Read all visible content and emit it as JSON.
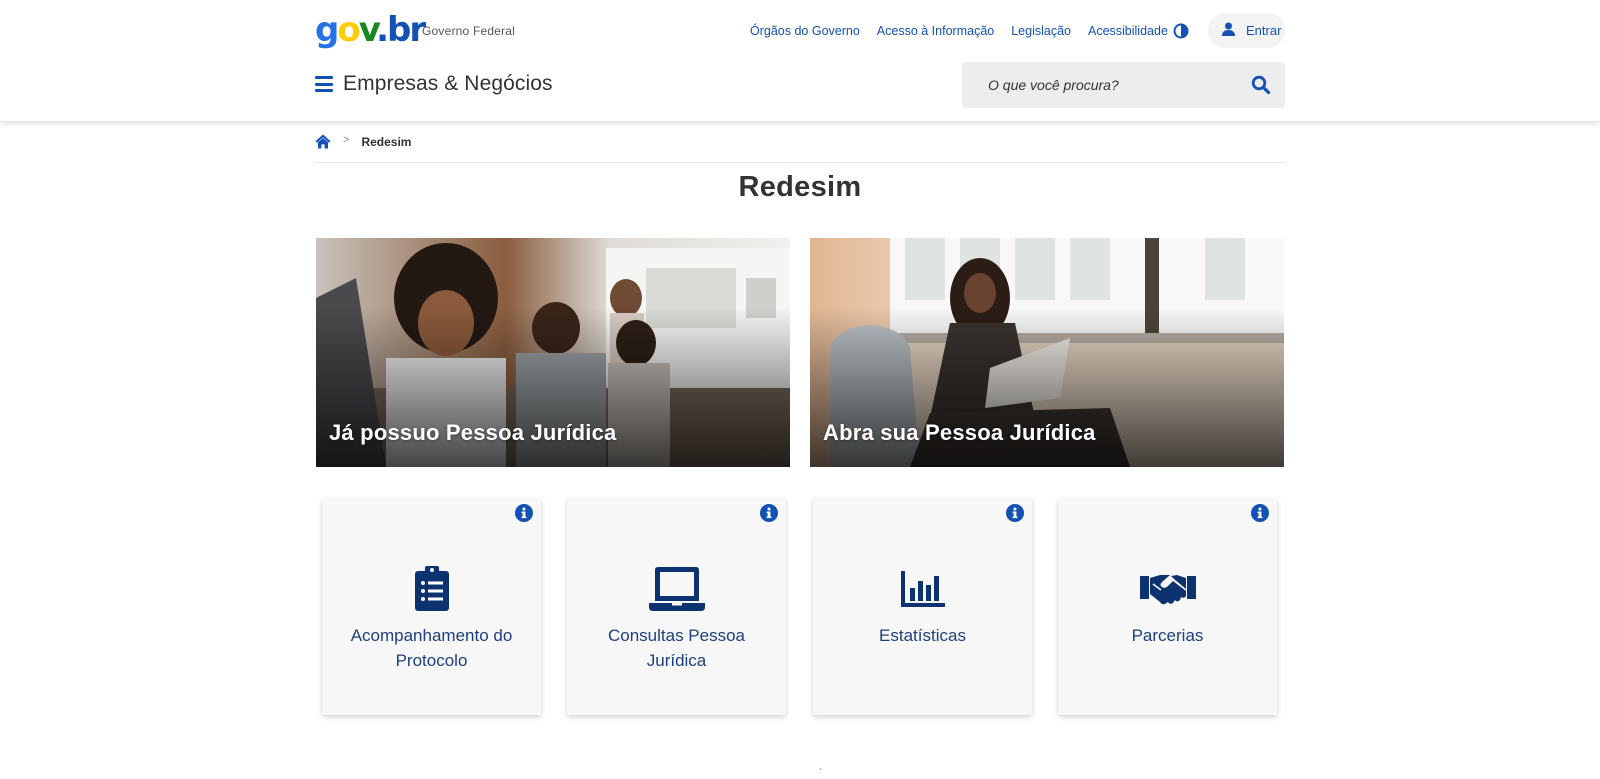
{
  "header": {
    "logo": {
      "part1": "g",
      "part2": "o",
      "part3": "v",
      "part4": ".br"
    },
    "gov_label": "Governo Federal",
    "links": [
      "Órgãos do Governo",
      "Acesso à Informação",
      "Legislação",
      "Acessibilidade"
    ],
    "login_label": "Entrar",
    "site_title": "Empresas & Negócios",
    "search_placeholder": "O que você procura?"
  },
  "breadcrumb": {
    "current": "Redesim"
  },
  "page_title": "Redesim",
  "hero_cards": [
    {
      "label": "Já possuo Pessoa Jurídica"
    },
    {
      "label": "Abra sua Pessoa Jurídica"
    }
  ],
  "service_cards": [
    {
      "label": "Acompanhamento do Protocolo",
      "icon": "clipboard-list-icon"
    },
    {
      "label": "Consultas Pessoa Jurídica",
      "icon": "laptop-icon"
    },
    {
      "label": "Estatísticas",
      "icon": "bar-chart-icon"
    },
    {
      "label": "Parcerias",
      "icon": "handshake-icon"
    }
  ],
  "colors": {
    "primary": "#1351b4",
    "dark_blue": "#0c326f",
    "text": "#333333",
    "card_bg": "#f7f7f7"
  }
}
